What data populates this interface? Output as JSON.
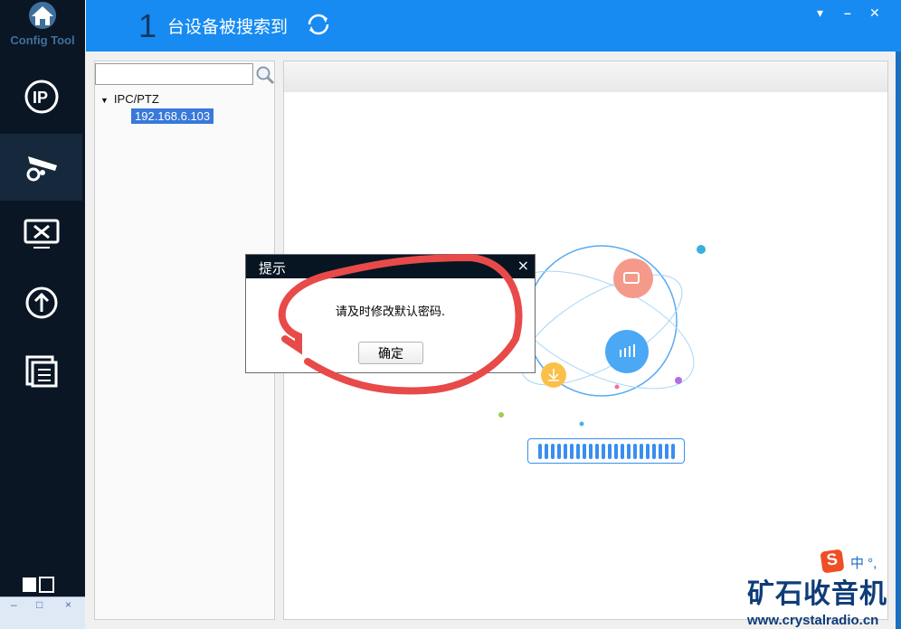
{
  "app": {
    "logo_label": "Config Tool"
  },
  "sidebar": {
    "items": [
      {
        "name": "ip-modify"
      },
      {
        "name": "device-config",
        "active": true
      },
      {
        "name": "system-settings"
      },
      {
        "name": "upgrade"
      },
      {
        "name": "documents"
      }
    ]
  },
  "header": {
    "count": "1",
    "title": "台设备被搜索到"
  },
  "left_panel": {
    "search_placeholder": "",
    "tree_root": "IPC/PTZ",
    "device_ip": "192.168.6.103"
  },
  "dialog": {
    "title": "提示",
    "message": "请及时修改默认密码.",
    "ok_label": "确定",
    "close": "×"
  },
  "progress": {
    "segments": 22
  },
  "ime": {
    "text": "中 °,"
  },
  "watermark": {
    "title": "矿石收音机",
    "url": "www.crystalradio.cn"
  },
  "colors": {
    "header": "#178bf2",
    "sidebar": "#0a1624",
    "accent": "#3a8ef0",
    "annotation": "#e84a4a"
  }
}
